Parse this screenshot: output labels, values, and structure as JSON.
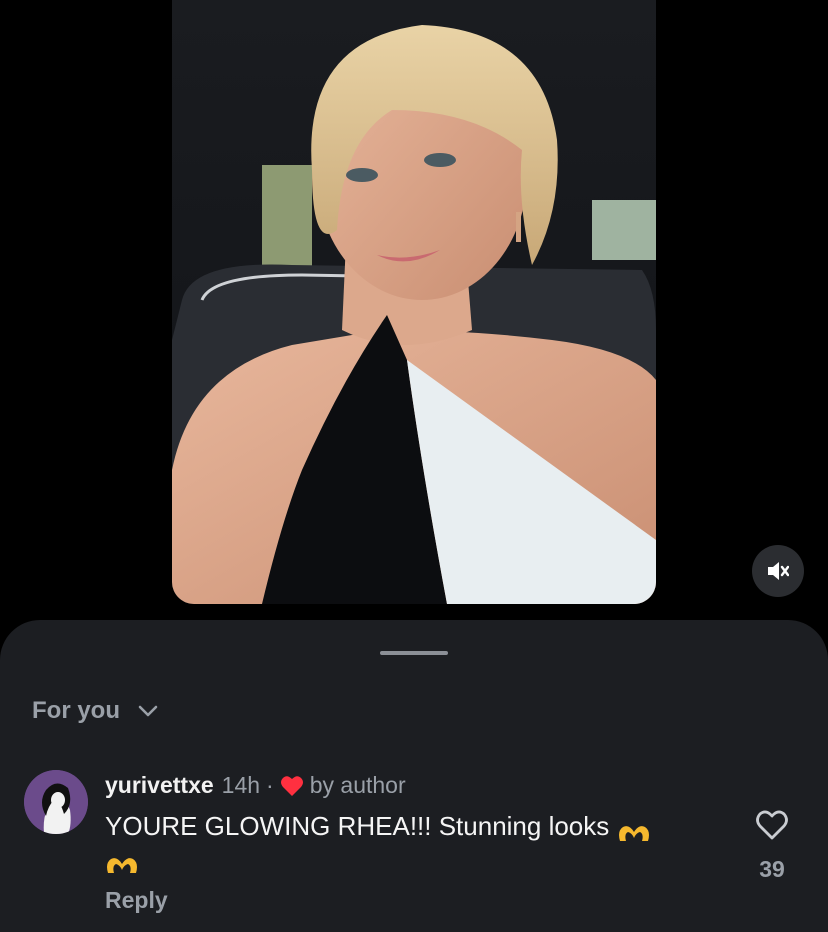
{
  "post": {
    "mute_icon": "speaker-muted-icon"
  },
  "sheet": {
    "sort_label": "For you",
    "sort_icon": "chevron-down-icon"
  },
  "comment": {
    "username": "yurivettxe",
    "time": "14h",
    "separator": "·",
    "liked_by_author_icon": "red-heart-icon",
    "liked_by_author_label": "by author",
    "text": "YOURE GLOWING RHEA!!! Stunning looks",
    "emoji": "heart-hands-emoji",
    "reply_label": "Reply",
    "like_icon": "heart-outline-icon",
    "like_count": "39",
    "heart_color": "#ff3040",
    "emoji_color": "#f5b82e"
  }
}
